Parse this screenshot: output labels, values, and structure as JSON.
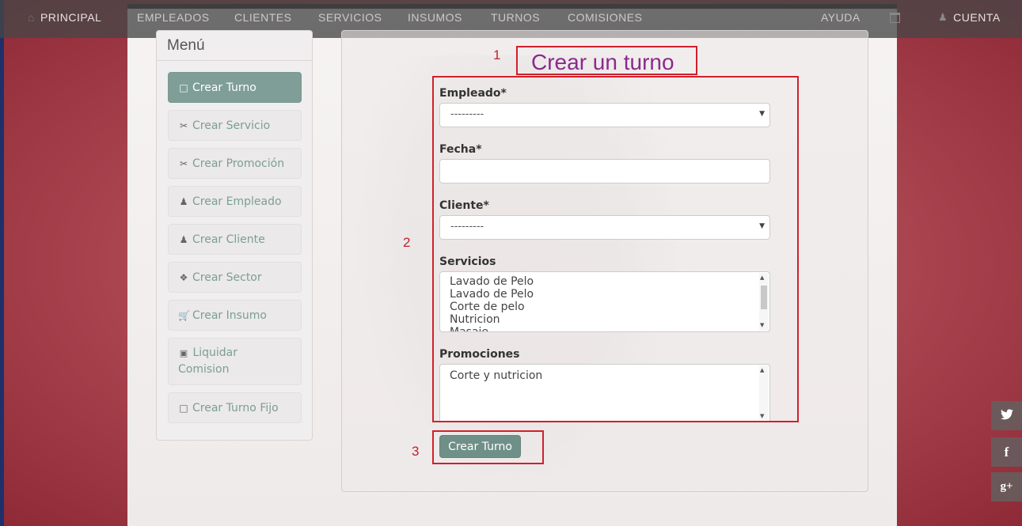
{
  "navbar": {
    "items": [
      {
        "label": "PRINCIPAL",
        "icon": "home-icon"
      },
      {
        "label": "EMPLEADOS"
      },
      {
        "label": "CLIENTES"
      },
      {
        "label": "SERVICIOS"
      },
      {
        "label": "INSUMOS"
      },
      {
        "label": "TURNOS"
      },
      {
        "label": "COMISIONES"
      },
      {
        "label": "AYUDA"
      },
      {
        "label": "CUENTA",
        "icon": "user-icon"
      }
    ],
    "calendar_icon": "calendar-icon"
  },
  "menu": {
    "title": "Menú",
    "items": [
      {
        "label": "Crear Turno",
        "icon": "calendar-icon",
        "active": true
      },
      {
        "label": "Crear Servicio",
        "icon": "scissors-icon"
      },
      {
        "label": "Crear Promoción",
        "icon": "scissors-icon"
      },
      {
        "label": "Crear Empleado",
        "icon": "user-icon"
      },
      {
        "label": "Crear Cliente",
        "icon": "user-icon"
      },
      {
        "label": "Crear Sector",
        "icon": "tags-icon"
      },
      {
        "label": "Crear Insumo",
        "icon": "cart-icon"
      },
      {
        "label": "Liquidar Comision",
        "icon": "money-icon"
      },
      {
        "label": "Crear Turno Fijo",
        "icon": "calendar-icon"
      }
    ]
  },
  "annotations": {
    "one": "1",
    "two": "2",
    "three": "3"
  },
  "form": {
    "title": "Crear un turno",
    "empleado": {
      "label": "Empleado*",
      "value": "---------"
    },
    "fecha": {
      "label": "Fecha*",
      "value": ""
    },
    "cliente": {
      "label": "Cliente*",
      "value": "---------"
    },
    "servicios": {
      "label": "Servicios",
      "options": [
        "Lavado de Pelo",
        "Lavado de Pelo",
        "Corte de pelo",
        "Nutricion",
        "Masaje"
      ]
    },
    "promociones": {
      "label": "Promociones",
      "options": [
        "Corte y nutricion"
      ]
    },
    "submit_label": "Crear Turno"
  },
  "social": {
    "twitter": {
      "icon": "twitter-icon"
    },
    "facebook": {
      "label": "f",
      "icon": "facebook-icon"
    },
    "googleplus": {
      "label": "g+",
      "icon": "google-plus-icon"
    }
  },
  "colors": {
    "accent": "#7f9e97",
    "annotation_red": "#d0202c",
    "title_purple": "#8a2a8c"
  }
}
